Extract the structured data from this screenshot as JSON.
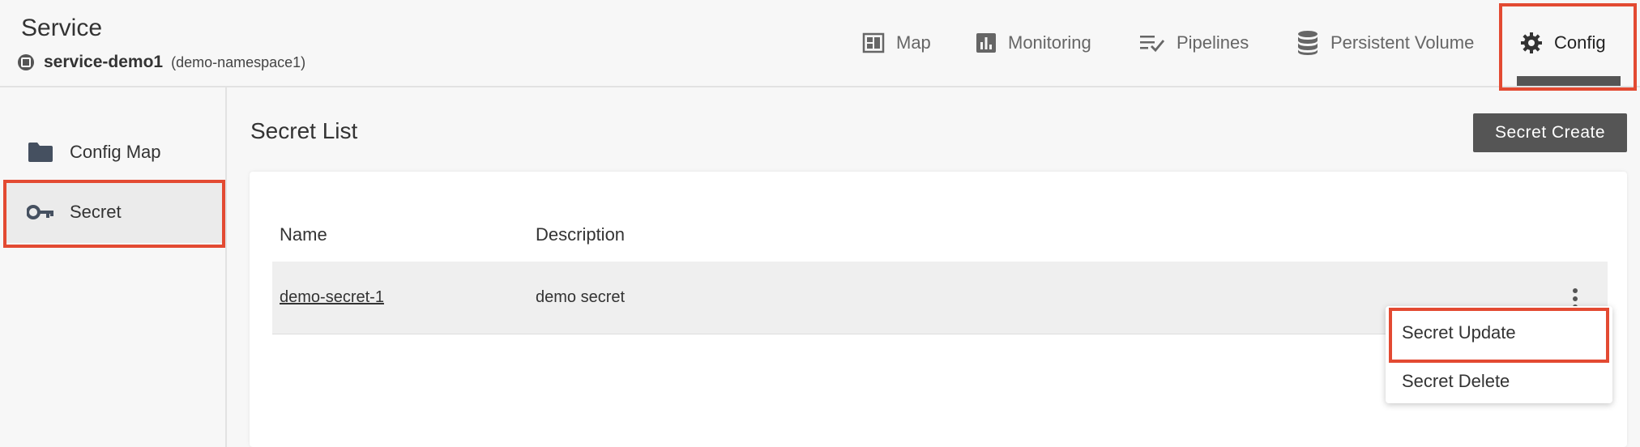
{
  "header": {
    "title": "Service",
    "service_name": "service-demo1",
    "namespace": "(demo-namespace1)"
  },
  "tabs": [
    {
      "label": "Map",
      "icon": "dashboard-icon"
    },
    {
      "label": "Monitoring",
      "icon": "bar-chart-icon"
    },
    {
      "label": "Pipelines",
      "icon": "checklist-icon"
    },
    {
      "label": "Persistent Volume",
      "icon": "database-icon"
    },
    {
      "label": "Config",
      "icon": "gear-icon",
      "active": true
    }
  ],
  "sidebar": {
    "items": [
      {
        "label": "Config Map",
        "icon": "folder-icon"
      },
      {
        "label": "Secret",
        "icon": "key-icon",
        "active": true
      }
    ]
  },
  "main": {
    "title": "Secret List",
    "create_label": "Secret Create",
    "columns": [
      "Name",
      "Description"
    ],
    "rows": [
      {
        "name": "demo-secret-1",
        "description": "demo secret"
      }
    ]
  },
  "context_menu": {
    "items": [
      "Secret Update",
      "Secret Delete"
    ]
  },
  "colors": {
    "highlight": "#e34a32",
    "button": "#555555"
  }
}
